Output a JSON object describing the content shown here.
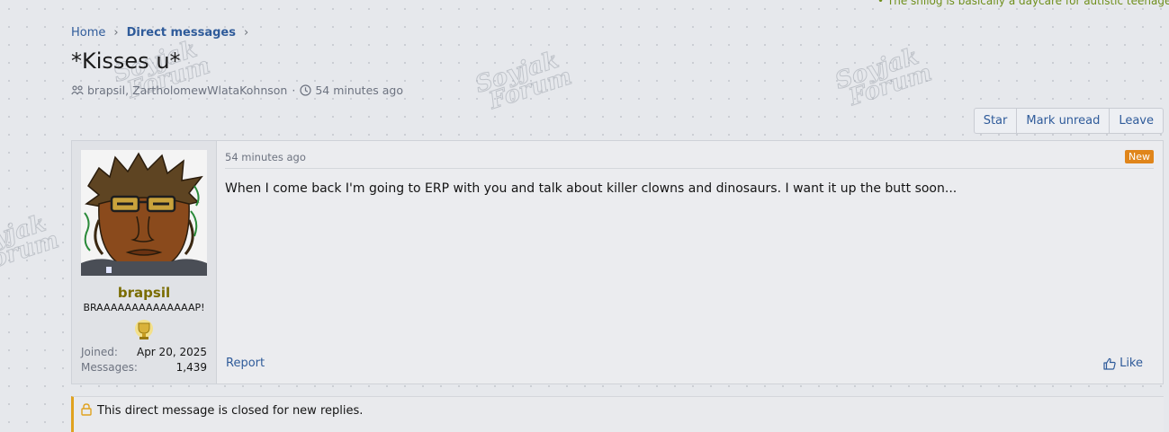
{
  "ticker": "• The shilog is basically a daycare for autistic teenagers, mo",
  "watermark": "Soyjak Forum",
  "breadcrumb": {
    "home": "Home",
    "current": "Direct messages",
    "separator": "›"
  },
  "thread": {
    "title": "*Kisses u*",
    "participants": "brapsil, ZartholomewWlataKohnson",
    "time": "54 minutes ago"
  },
  "actions": {
    "star": "Star",
    "mark_unread": "Mark unread",
    "leave": "Leave"
  },
  "message": {
    "time": "54 minutes ago",
    "badge": "New",
    "body": "When I come back I'm going to ERP with you and talk about killer clowns and dinosaurs. I want it up the butt soon...",
    "report": "Report",
    "like": "Like"
  },
  "user": {
    "name": "brapsil",
    "title": "BRAAAAAAAAAAAAAAP!",
    "joined_label": "Joined:",
    "joined": "Apr 20, 2025",
    "messages_label": "Messages:",
    "messages": "1,439"
  },
  "notice": "This direct message is closed for new replies.",
  "colors": {
    "link": "#2f5b9a",
    "username": "#7a6c00",
    "new_badge": "#e0851a",
    "notice_border": "#e0a21f"
  }
}
